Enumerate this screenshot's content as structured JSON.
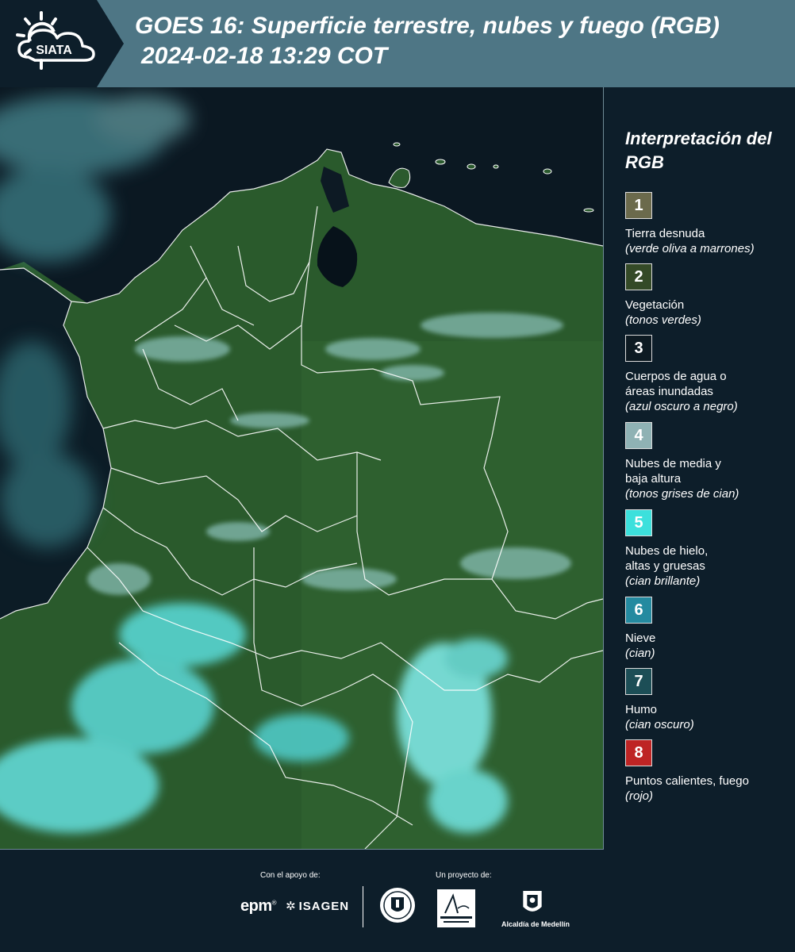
{
  "header": {
    "title": "GOES 16: Superficie terrestre, nubes y fuego (RGB)",
    "subtitle": "2024-02-18 13:29 COT",
    "logo_text": "SIATA"
  },
  "legend": {
    "title": "Interpretación del RGB",
    "items": [
      {
        "num": "1",
        "label": "Tierra desnuda",
        "note": "(verde oliva a marrones)",
        "color": "#6b6a4c"
      },
      {
        "num": "2",
        "label": "Vegetación",
        "note": "(tonos verdes)",
        "color": "#344a27"
      },
      {
        "num": "3",
        "label": "Cuerpos de agua o áreas inundadas",
        "note": "(azul oscuro a negro)",
        "color": "#0d1a22"
      },
      {
        "num": "4",
        "label": "Nubes de media y baja altura",
        "note": "(tonos grises de cian)",
        "color": "#8fb2b4"
      },
      {
        "num": "5",
        "label": "Nubes de hielo, altas y gruesas",
        "note": "(cian brillante)",
        "color": "#3ce0dc"
      },
      {
        "num": "6",
        "label": "Nieve",
        "note": "(cian)",
        "color": "#248aa0"
      },
      {
        "num": "7",
        "label": "Humo",
        "note": "(cian oscuro)",
        "color": "#1c4e56"
      },
      {
        "num": "8",
        "label": "Puntos calientes, fuego",
        "note": "(rojo)",
        "color": "#be2424"
      }
    ]
  },
  "footer": {
    "support_label": "Con el apoyo de:",
    "project_label": "Un proyecto de:",
    "epm": "epm",
    "isagen": "ISAGEN",
    "alcaldia": "Alcaldía de Medellín"
  }
}
